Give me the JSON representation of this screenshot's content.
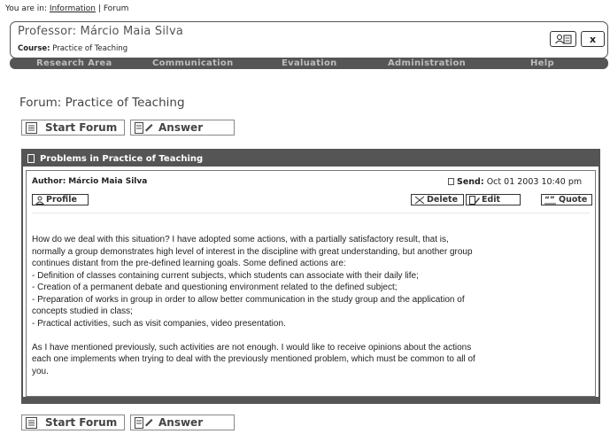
{
  "breadcrumb": {
    "prefix": "You are in:",
    "link": "Information",
    "separator": "|",
    "current": "Forum"
  },
  "header": {
    "professor": "Professor: Márcio Maia Silva",
    "course_label": "Course:",
    "course_value": "Practice of Teaching",
    "close_label": "x"
  },
  "menu": [
    "Research Area",
    "Communication",
    "Evaluation",
    "Administration",
    "Help"
  ],
  "forum_title": "Forum: Practice of Teaching",
  "buttons": {
    "start_forum": "Start Forum",
    "answer": "Answer"
  },
  "post": {
    "title": "Problems in Practice of Teaching",
    "author_label": "Author:",
    "author_name": "Márcio Maia Silva",
    "send_label": "Send",
    "send_date": "Oct 01 2003 10:40 pm",
    "profile": "Profile",
    "delete": "Delete",
    "edit": "Edit",
    "quote": "Quote",
    "lines": [
      "How do we deal with this situation? I have adopted some actions, with a partially satisfactory result, that is,",
      "normally a group demonstrates high level of interest in the discipline with great understanding, but another group",
      "continues distant from the pre-defined learning goals. Some defined actions are:",
      "- Definition of classes containing current subjects, which students can associate with their daily life;",
      "- Creation of a permanent debate and questioning environment related to the defined subject;",
      "- Preparation of works in group in order to allow better communication in the study group and the application of",
      "concepts studied in class;",
      "- Practical activities, such as visit companies, video presentation.",
      "",
      "As I have mentioned previously, such activities are not enough. I would like to receive opinions about the actions",
      "each one implements when trying to deal with the previously mentioned problem, which must be common to all of",
      "you."
    ]
  }
}
